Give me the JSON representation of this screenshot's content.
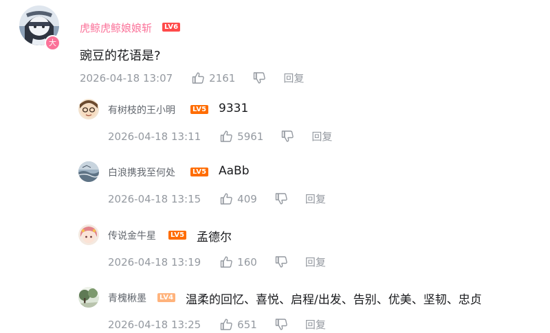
{
  "comment": {
    "author": "虎鲸虎鲸娘娘斩",
    "level": "LV6",
    "vip_badge": "大",
    "content": "豌豆的花语是?",
    "time": "2026-04-18 13:07",
    "likes": "2161",
    "reply_label": "回复",
    "colors": {
      "vip_name": "#fb7299",
      "meta": "#9499a0"
    }
  },
  "replies": [
    {
      "author": "有树枝的王小明",
      "level": "LV5",
      "content": "9331",
      "time": "2026-04-18 13:11",
      "likes": "5961",
      "reply_label": "回复"
    },
    {
      "author": "白浪携我至何处",
      "level": "LV5",
      "content": "AaBb",
      "time": "2026-04-18 13:15",
      "likes": "409",
      "reply_label": "回复"
    },
    {
      "author": "传说金牛星",
      "level": "LV5",
      "content": "孟德尔",
      "time": "2026-04-18 13:19",
      "likes": "160",
      "reply_label": "回复"
    },
    {
      "author": "青槐楸墨",
      "level": "LV4",
      "content": "温柔的回忆、喜悦、启程/出发、告别、优美、坚韧、忠贞",
      "time": "2026-04-18 13:25",
      "likes": "651",
      "reply_label": "回复"
    }
  ]
}
